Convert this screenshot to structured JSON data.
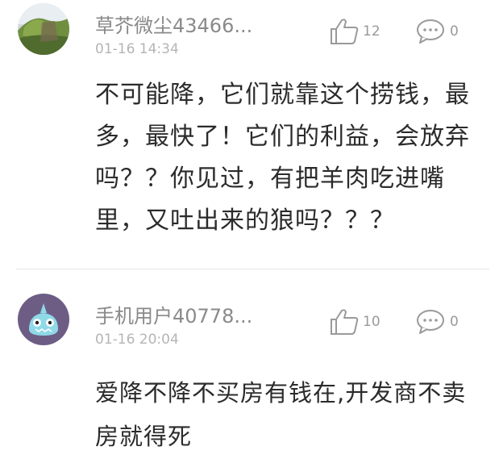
{
  "comments": [
    {
      "username": "草芥微尘43466...",
      "time": "01-16 14:34",
      "likes": "12",
      "replies": "0",
      "text": "不可能降，它们就靠这个捞钱，最多，最快了！它们的利益，会放弃吗？？你见过，有把羊肉吃进嘴里，又吐出来的狼吗？？？",
      "avatar_icon": "landscape-avatar-icon"
    },
    {
      "username": "手机用户40778...",
      "time": "01-16 20:04",
      "likes": "10",
      "replies": "0",
      "text": "爱降不降不买房有钱在,开发商不卖房就得死",
      "avatar_icon": "monster-avatar-icon"
    }
  ],
  "colors": {
    "username": "#8a8a8a",
    "time": "#b5b5b5",
    "text": "#2b2b2b",
    "icon": "#9a9a9a",
    "avatar2_bg": "#6d5d85"
  }
}
